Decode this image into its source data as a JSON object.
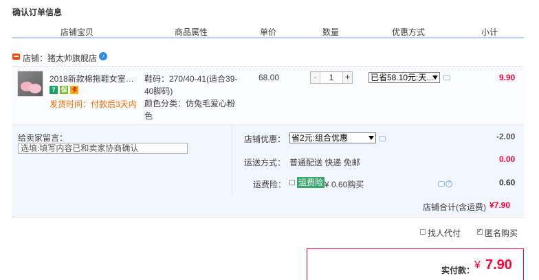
{
  "page": {
    "title": "确认订单信息"
  },
  "table_header": {
    "shop_item": "店铺宝贝",
    "attributes": "商品属性",
    "unit_price": "单价",
    "quantity": "数量",
    "discount_method": "优惠方式",
    "subtotal": "小计"
  },
  "shop": {
    "label": "店铺：猪太帅旗舰店"
  },
  "item": {
    "name": "2018新款棉拖鞋女室内...",
    "service_badges": [
      "7",
      "保",
      "卡"
    ],
    "ship_time": "发货时间：付款后3天内",
    "sku_code": "鞋码：270/40-41(适合39-40脚码)",
    "color": "颜色分类：仿兔毛爱心粉色",
    "price": "68.00",
    "quantity": "1",
    "minus_label": "-",
    "plus_label": "+",
    "discount_select": "已省58.10元:天...",
    "subtotal": "9.90"
  },
  "extras": {
    "message_label": "给卖家留言：",
    "message_placeholder": "选填:填写内容已和卖家协商确认",
    "shop_discount_label": "店铺优惠：",
    "shop_discount_select": "省2元:组合优惠",
    "shop_discount_value": "-2.00",
    "shipping_label": "运送方式：",
    "shipping_value": "普通配送 快递 免邮",
    "shipping_cost": "0.00",
    "insurance_label": "运费险：",
    "insurance_badge": "运费险",
    "insurance_price": "¥ 0.60购买",
    "insurance_value": "0.60",
    "shop_total_label": "店铺合计(含运费)",
    "shop_total_value": "¥7.90"
  },
  "options": {
    "proxy_pay": "找人代付",
    "anonymous": "匿名购买"
  },
  "payment": {
    "label": "实付款：",
    "currency": "¥",
    "amount": "7.90"
  },
  "colors": {
    "accent_red": "#ff0036",
    "orange": "#ff6a00",
    "blue_line": "#b2d1ff",
    "panel_bg": "#f2f7ff"
  }
}
